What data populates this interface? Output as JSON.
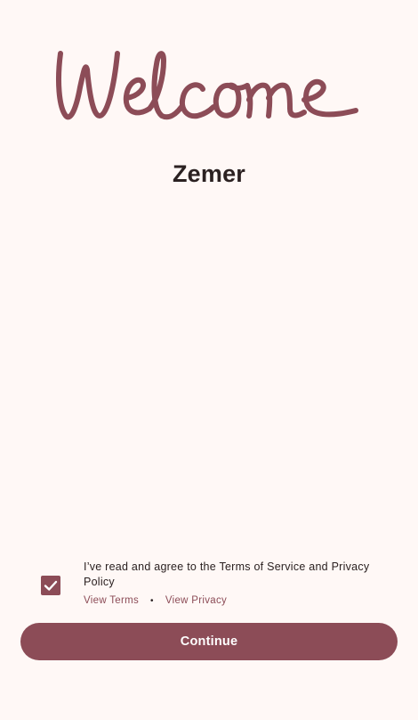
{
  "welcome": {
    "logo_text": "Welcome",
    "logo_color": "#8c4c57"
  },
  "app": {
    "name": "Zemer"
  },
  "agreement": {
    "checked": true,
    "text": "I’ve read and agree to the Terms of Service and Privacy Policy",
    "view_terms_label": "View Terms",
    "separator": "•",
    "view_privacy_label": "View Privacy"
  },
  "actions": {
    "continue_label": "Continue"
  },
  "colors": {
    "background": "#fff8f6",
    "accent": "#8c4c57",
    "text": "#2b2121"
  }
}
